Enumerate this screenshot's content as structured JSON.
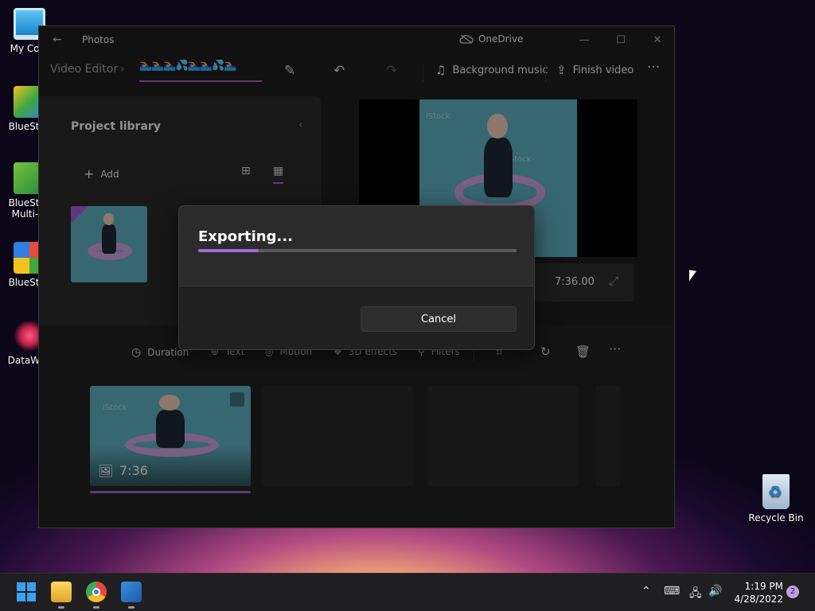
{
  "desktop": {
    "icons": [
      {
        "label": "My Com",
        "color": "#2fa7e8"
      },
      {
        "label": "BlueStac",
        "color": "#3fa83f"
      },
      {
        "label": "BlueStac Multi-In",
        "color": "#79c23b"
      },
      {
        "label": "BlueStac",
        "color": "#e84d3c"
      },
      {
        "label": "DataWag",
        "color": "#c0234a"
      }
    ],
    "recycle_bin": "Recycle Bin"
  },
  "window": {
    "app_title": "Photos",
    "onedrive_label": "OneDrive",
    "breadcrumb_root": "Video Editor",
    "project_name": "🏊‍♀️🏊‍♀️🏊‍♀️💦🏊‍♀️🏊‍♀️💦🏊‍♀️",
    "background_music": "Background music",
    "finish_video": "Finish video"
  },
  "library": {
    "title": "Project library",
    "add_label": "Add"
  },
  "preview": {
    "time": "7:36.00",
    "watermark": "iStock"
  },
  "storyboard": {
    "tools": {
      "duration": "Duration",
      "text": "Text",
      "motion": "Motion",
      "effects_3d": "3D effects",
      "filters": "Filters"
    },
    "clip_duration": "7:36"
  },
  "dialog": {
    "title": "Exporting...",
    "progress": 0.19,
    "cancel_label": "Cancel"
  },
  "taskbar": {
    "time": "1:19 PM",
    "date": "4/28/2022",
    "notifications": "2"
  },
  "colors": {
    "accent": "#9b59c9",
    "progress": "#a76ad8"
  }
}
